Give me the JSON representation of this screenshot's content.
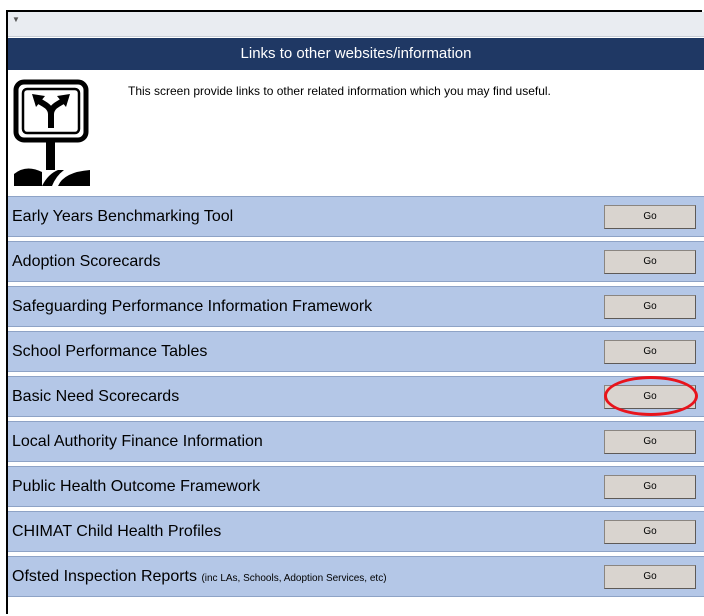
{
  "qat": {
    "arrow_icon": "customize-toolbar-arrow-icon"
  },
  "header": {
    "title": "Links to other websites/information"
  },
  "intro": {
    "icon": "road-sign-arrows-icon",
    "text": "This screen provide links to other related information which you may find useful."
  },
  "links": [
    {
      "label": "Early Years Benchmarking Tool",
      "sublabel": "",
      "button": "Go"
    },
    {
      "label": "Adoption Scorecards",
      "sublabel": "",
      "button": "Go"
    },
    {
      "label": "Safeguarding Performance Information Framework",
      "sublabel": "",
      "button": "Go"
    },
    {
      "label": "School Performance Tables",
      "sublabel": "",
      "button": "Go"
    },
    {
      "label": "Basic Need Scorecards",
      "sublabel": "",
      "button": "Go"
    },
    {
      "label": "Local Authority Finance Information",
      "sublabel": "",
      "button": "Go"
    },
    {
      "label": "Public Health Outcome Framework",
      "sublabel": "",
      "button": "Go"
    },
    {
      "label": "CHIMAT Child Health Profiles",
      "sublabel": "",
      "button": "Go"
    },
    {
      "label": "Ofsted Inspection Reports ",
      "sublabel": "(inc LAs, Schools, Adoption Services, etc)",
      "button": "Go"
    }
  ],
  "annotation": {
    "highlighted_row": "Basic Need Scorecards",
    "ring_color": "#e8141c"
  },
  "colors": {
    "title_bar": "#1f3864",
    "row_background": "#b4c7e7",
    "button_face": "#d9d4cf"
  }
}
